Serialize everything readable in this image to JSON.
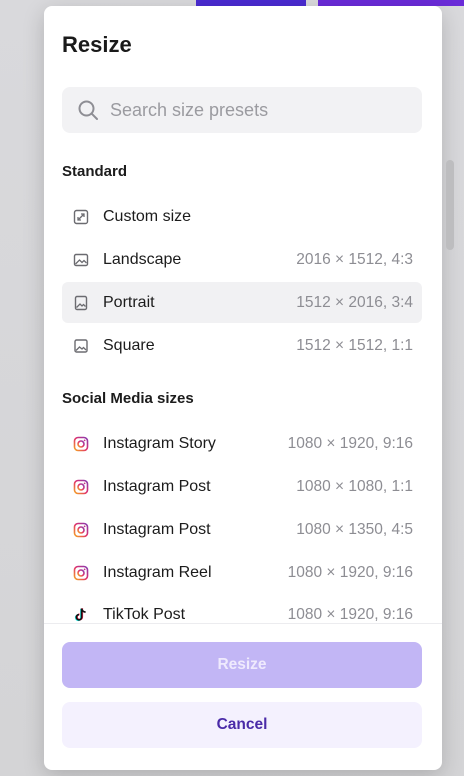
{
  "panel": {
    "title": "Resize"
  },
  "search": {
    "placeholder": "Search size presets",
    "icon": "search-icon"
  },
  "sections": {
    "standard": {
      "heading": "Standard",
      "items": [
        {
          "label": "Custom size",
          "meta": "",
          "icon": "resize-icon",
          "selected": false
        },
        {
          "label": "Landscape",
          "meta": "2016 × 1512, 4:3",
          "icon": "image-icon",
          "selected": false
        },
        {
          "label": "Portrait",
          "meta": "1512 × 2016, 3:4",
          "icon": "image-icon",
          "selected": true
        },
        {
          "label": "Square",
          "meta": "1512 × 1512, 1:1",
          "icon": "image-icon",
          "selected": false
        }
      ]
    },
    "social": {
      "heading": "Social Media sizes",
      "items": [
        {
          "label": "Instagram Story",
          "meta": "1080 × 1920, 9:16",
          "icon": "instagram-icon"
        },
        {
          "label": "Instagram Post",
          "meta": "1080 × 1080, 1:1",
          "icon": "instagram-icon"
        },
        {
          "label": "Instagram Post",
          "meta": "1080 × 1350, 4:5",
          "icon": "instagram-icon"
        },
        {
          "label": "Instagram Reel",
          "meta": "1080 × 1920, 9:16",
          "icon": "instagram-icon"
        },
        {
          "label": "TikTok Post",
          "meta": "1080 × 1920, 9:16",
          "icon": "tiktok-icon"
        }
      ]
    }
  },
  "buttons": {
    "resize": "Resize",
    "cancel": "Cancel"
  },
  "colors": {
    "accent": "#4a2ba8",
    "primary_disabled": "#c2b6f5",
    "selected_row": "#f1f1f3"
  }
}
